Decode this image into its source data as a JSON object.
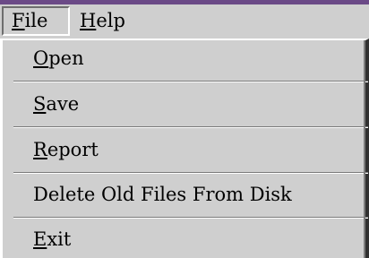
{
  "menubar": {
    "file_label": "File",
    "help_label": "Help"
  },
  "file_menu": {
    "items": [
      {
        "label": "Open",
        "mnemonic": "O",
        "rest": "pen"
      },
      {
        "label": "Save",
        "mnemonic": "S",
        "rest": "ave"
      },
      {
        "label": "Report",
        "mnemonic": "R",
        "rest": "eport"
      },
      {
        "label": "Delete Old Files From Disk",
        "mnemonic": "",
        "rest": "Delete Old Files From Disk"
      },
      {
        "label": "Exit",
        "mnemonic": "E",
        "rest": "xit"
      }
    ]
  },
  "colors": {
    "menu_bg": "#cfcfcf",
    "title_strip": "#6b4a87",
    "text": "#000000"
  }
}
